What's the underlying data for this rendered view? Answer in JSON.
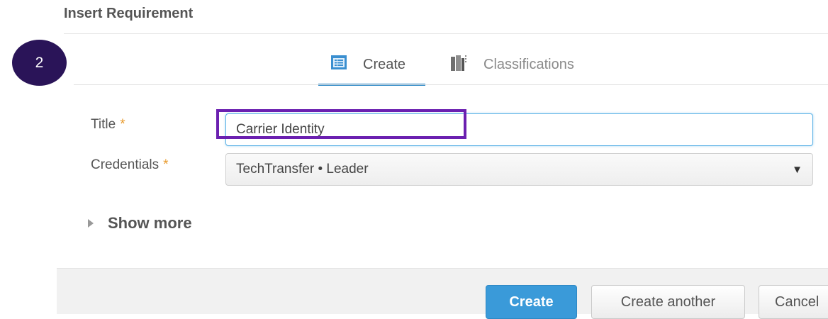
{
  "dialog": {
    "title": "Insert Requirement"
  },
  "step_badge": "2",
  "tabs": [
    {
      "label": "Create",
      "icon": "form-icon",
      "active": true
    },
    {
      "label": "Classifications",
      "icon": "classification-icon",
      "active": false
    }
  ],
  "form": {
    "title_field": {
      "label": "Title",
      "required_marker": "*",
      "value": "Carrier Identity"
    },
    "credentials_field": {
      "label": "Credentials",
      "required_marker": "*",
      "value": "TechTransfer • Leader"
    },
    "show_more_label": "Show more"
  },
  "buttons": {
    "create": "Create",
    "create_another": "Create another",
    "cancel": "Cancel"
  },
  "colors": {
    "accent": "#3a9ad9",
    "highlight": "#6b20b0",
    "badge": "#2a1458",
    "required": "#e89a2c"
  }
}
